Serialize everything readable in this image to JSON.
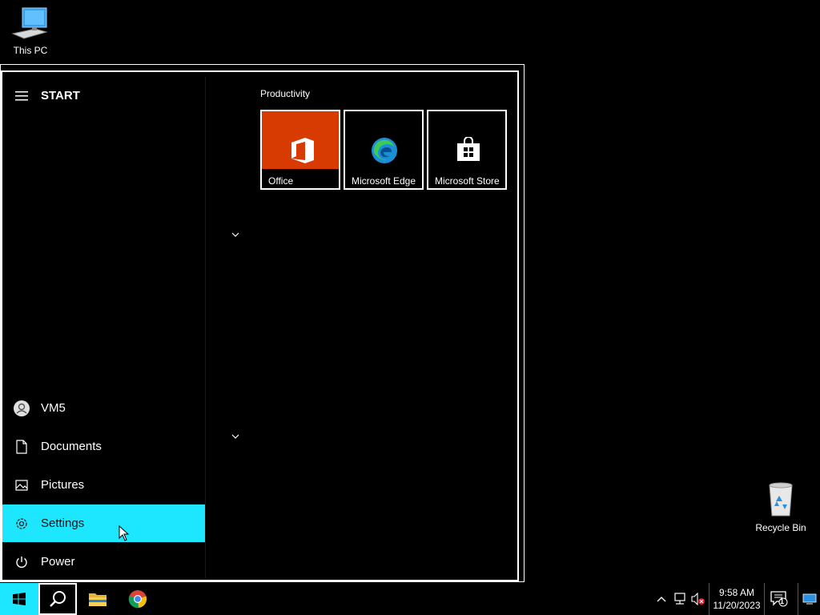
{
  "desktop": {
    "this_pc": "This PC",
    "recycle_bin": "Recycle Bin"
  },
  "start_menu": {
    "header": "START",
    "user": "VM5",
    "documents": "Documents",
    "pictures": "Pictures",
    "settings": "Settings",
    "power": "Power",
    "group_title": "Productivity",
    "tiles": [
      "Office",
      "Microsoft Edge",
      "Microsoft Store"
    ]
  },
  "taskbar": {
    "apps": [
      "windows-start-icon",
      "search-icon",
      "file-explorer-icon",
      "chrome-icon"
    ],
    "time": "9:58 AM",
    "date": "11/20/2023",
    "notification_count": "1"
  },
  "colors": {
    "highlight": "#1de6ff",
    "office_tile": "#d83b01"
  }
}
